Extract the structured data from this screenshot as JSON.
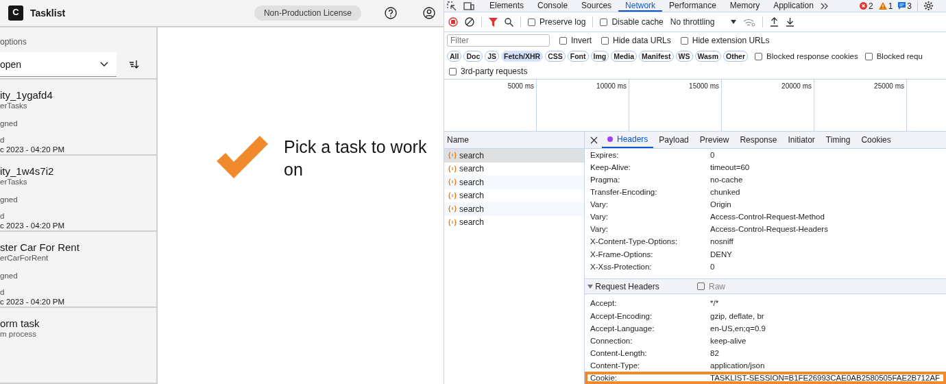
{
  "tasklist": {
    "header": {
      "logo_text": "C",
      "title": "Tasklist",
      "license": "Non-Production License"
    },
    "filter": {
      "label": "options",
      "value": "open"
    },
    "tasks": [
      {
        "name": "ity_1ygafd4",
        "process": "erTasks",
        "assignee": "gned",
        "date_label": "d",
        "date": "c 2023 - 04:20 PM"
      },
      {
        "name": "ity_1w4s7i2",
        "process": "erTasks",
        "assignee": "gned",
        "date_label": "d",
        "date": "c 2023 - 04:20 PM"
      },
      {
        "name": "ster Car For Rent",
        "process": "erCarForRent",
        "assignee": "gned",
        "date_label": "d",
        "date": "c 2023 - 04:20 PM"
      },
      {
        "name": "orm task",
        "process": "m process"
      }
    ],
    "empty_state": "Pick a task to work on"
  },
  "devtools": {
    "tabs": [
      {
        "label": "Elements",
        "selected": false
      },
      {
        "label": "Console",
        "selected": false
      },
      {
        "label": "Sources",
        "selected": false
      },
      {
        "label": "Network",
        "selected": true
      },
      {
        "label": "Performance",
        "selected": false
      },
      {
        "label": "Memory",
        "selected": false
      },
      {
        "label": "Application",
        "selected": false
      }
    ],
    "counts": {
      "errors": "2",
      "warnings": "1",
      "messages": "3"
    },
    "toolbar": {
      "preserve_log": {
        "label": "Preserve log",
        "checked": false
      },
      "disable_cache": {
        "label": "Disable cache",
        "checked": false
      },
      "throttling": "No throttling"
    },
    "filter": {
      "placeholder": "Filter",
      "options": [
        {
          "label": "Invert",
          "checked": false
        },
        {
          "label": "Hide data URLs",
          "checked": false
        },
        {
          "label": "Hide extension URLs",
          "checked": false
        }
      ]
    },
    "types": [
      {
        "label": "All",
        "selected": false
      },
      {
        "label": "Doc",
        "selected": false
      },
      {
        "label": "JS",
        "selected": false
      },
      {
        "label": "Fetch/XHR",
        "selected": true
      },
      {
        "label": "CSS",
        "selected": false
      },
      {
        "label": "Font",
        "selected": false
      },
      {
        "label": "Img",
        "selected": false
      },
      {
        "label": "Media",
        "selected": false
      },
      {
        "label": "Manifest",
        "selected": false
      },
      {
        "label": "WS",
        "selected": false
      },
      {
        "label": "Wasm",
        "selected": false
      },
      {
        "label": "Other",
        "selected": false
      }
    ],
    "type_options": [
      {
        "label": "Blocked response cookies",
        "checked": false
      },
      {
        "label": "Blocked requ",
        "checked": false
      }
    ],
    "third_party": {
      "label": "3rd-party requests",
      "checked": false
    },
    "timeline_ticks": [
      "5000 ms",
      "10000 ms",
      "15000 ms",
      "20000 ms",
      "25000 ms"
    ],
    "requests": {
      "column": "Name",
      "rows": [
        {
          "name": "search",
          "selected": true
        },
        {
          "name": "search",
          "selected": false
        },
        {
          "name": "search",
          "selected": false
        },
        {
          "name": "search",
          "selected": false
        },
        {
          "name": "search",
          "selected": false
        },
        {
          "name": "search",
          "selected": false
        }
      ]
    },
    "detail_tabs": [
      {
        "label": "Headers",
        "selected": true
      },
      {
        "label": "Payload",
        "selected": false
      },
      {
        "label": "Preview",
        "selected": false
      },
      {
        "label": "Response",
        "selected": false
      },
      {
        "label": "Initiator",
        "selected": false
      },
      {
        "label": "Timing",
        "selected": false
      },
      {
        "label": "Cookies",
        "selected": false
      }
    ],
    "response_headers": [
      {
        "name": "Expires:",
        "value": "0",
        "highlighted": false
      },
      {
        "name": "Keep-Alive:",
        "value": "timeout=60",
        "highlighted": false
      },
      {
        "name": "Pragma:",
        "value": "no-cache",
        "highlighted": false
      },
      {
        "name": "Transfer-Encoding:",
        "value": "chunked",
        "highlighted": false
      },
      {
        "name": "Vary:",
        "value": "Origin",
        "highlighted": false
      },
      {
        "name": "Vary:",
        "value": "Access-Control-Request-Method",
        "highlighted": false
      },
      {
        "name": "Vary:",
        "value": "Access-Control-Request-Headers",
        "highlighted": false
      },
      {
        "name": "X-Content-Type-Options:",
        "value": "nosniff",
        "highlighted": false
      },
      {
        "name": "X-Frame-Options:",
        "value": "DENY",
        "highlighted": false
      },
      {
        "name": "X-Xss-Protection:",
        "value": "0",
        "highlighted": false
      }
    ],
    "request_section": {
      "title": "Request Headers",
      "expanded": true,
      "raw": {
        "label": "Raw",
        "checked": false
      }
    },
    "request_headers": [
      {
        "name": "Accept:",
        "value": "*/*",
        "highlighted": false
      },
      {
        "name": "Accept-Encoding:",
        "value": "gzip, deflate, br",
        "highlighted": false
      },
      {
        "name": "Accept-Language:",
        "value": "en-US,en;q=0.9",
        "highlighted": false
      },
      {
        "name": "Connection:",
        "value": "keep-alive",
        "highlighted": false
      },
      {
        "name": "Content-Length:",
        "value": "82",
        "highlighted": false
      },
      {
        "name": "Content-Type:",
        "value": "application/json",
        "highlighted": false
      },
      {
        "name": "Cookie:",
        "value": "TASKLIST-SESSION=B1FE26993CAE0AB2580505FAE2B712AF",
        "highlighted": true
      }
    ]
  }
}
